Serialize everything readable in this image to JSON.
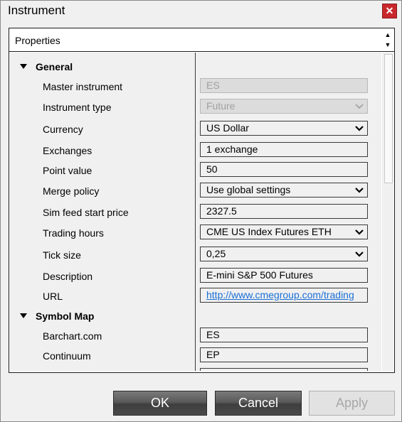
{
  "window": {
    "title": "Instrument",
    "close_glyph": "✕"
  },
  "panel": {
    "header": "Properties",
    "scroll_up": "▲",
    "scroll_down": "▼"
  },
  "categories": {
    "general": "General",
    "symbol_map": "Symbol Map"
  },
  "properties": [
    {
      "label": "Master instrument",
      "value": "ES",
      "kind": "text",
      "disabled": true
    },
    {
      "label": "Instrument type",
      "value": "Future",
      "kind": "select",
      "disabled": true
    },
    {
      "label": "Currency",
      "value": "US Dollar",
      "kind": "select",
      "disabled": false
    },
    {
      "label": "Exchanges",
      "value": "1 exchange",
      "kind": "text",
      "disabled": false
    },
    {
      "label": "Point value",
      "value": "50",
      "kind": "text",
      "disabled": false
    },
    {
      "label": "Merge policy",
      "value": "Use global settings",
      "kind": "select",
      "disabled": false
    },
    {
      "label": "Sim feed start price",
      "value": "2327.5",
      "kind": "text",
      "disabled": false
    },
    {
      "label": "Trading hours",
      "value": "CME US Index Futures ETH",
      "kind": "select",
      "disabled": false
    },
    {
      "label": "Tick size",
      "value": "0,25",
      "kind": "select",
      "disabled": false
    },
    {
      "label": "Description",
      "value": "E-mini S&P 500 Futures",
      "kind": "text",
      "disabled": false
    },
    {
      "label": "URL",
      "value": "http://www.cmegroup.com/trading",
      "kind": "link",
      "disabled": false
    }
  ],
  "symbol_map": [
    {
      "label": "Barchart.com",
      "value": "ES"
    },
    {
      "label": "Continuum",
      "value": "EP"
    }
  ],
  "buttons": {
    "ok": "OK",
    "cancel": "Cancel",
    "apply": "Apply"
  }
}
